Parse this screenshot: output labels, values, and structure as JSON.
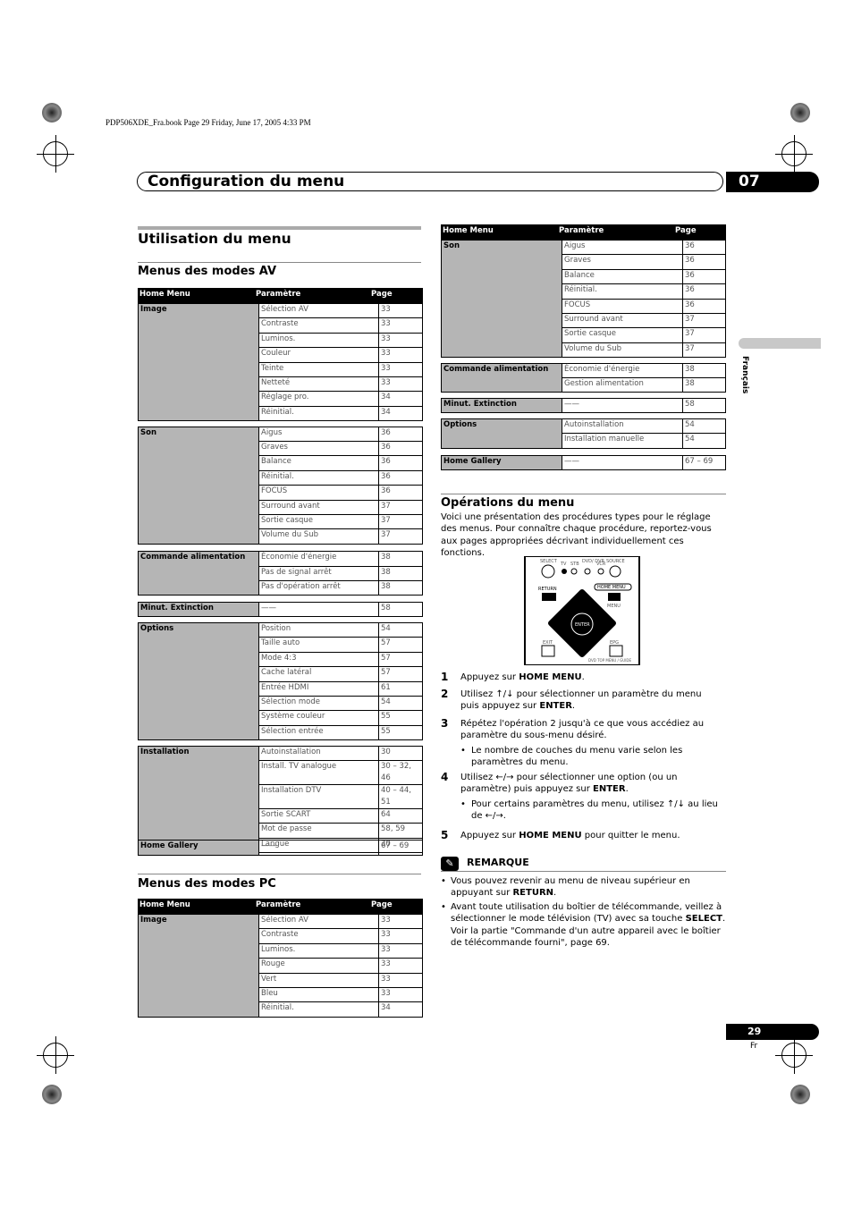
{
  "book_line": "PDP506XDE_Fra.book  Page 29  Friday, June 17, 2005  4:33 PM",
  "header": {
    "title": "Configuration du menu",
    "chapter": "07"
  },
  "side_tab": "Français",
  "section_title": "Utilisation du menu",
  "av": {
    "title": "Menus des modes AV",
    "columns": [
      "Home Menu",
      "Paramètre",
      "Page"
    ],
    "groups": [
      {
        "menu": "Image",
        "rows": [
          [
            "Sélection AV",
            "33"
          ],
          [
            "Contraste",
            "33"
          ],
          [
            "Luminos.",
            "33"
          ],
          [
            "Couleur",
            "33"
          ],
          [
            "Teinte",
            "33"
          ],
          [
            "Netteté",
            "33"
          ],
          [
            "Réglage pro.",
            "34"
          ],
          [
            "Réinitial.",
            "34"
          ]
        ]
      },
      {
        "menu": "Son",
        "rows": [
          [
            "Aigus",
            "36"
          ],
          [
            "Graves",
            "36"
          ],
          [
            "Balance",
            "36"
          ],
          [
            "Réinitial.",
            "36"
          ],
          [
            "FOCUS",
            "36"
          ],
          [
            "Surround avant",
            "37"
          ],
          [
            "Sortie casque",
            "37"
          ],
          [
            "Volume du Sub",
            "37"
          ]
        ]
      },
      {
        "menu": "Commande alimentation",
        "rows": [
          [
            "Économie d'énergie",
            "38"
          ],
          [
            "Pas de signal arrêt",
            "38"
          ],
          [
            "Pas d'opération arrêt",
            "38"
          ]
        ]
      },
      {
        "menu": "Minut. Extinction",
        "rows": [
          [
            "——",
            "58"
          ]
        ]
      },
      {
        "menu": "Options",
        "rows": [
          [
            "Position",
            "54"
          ],
          [
            "Taille auto",
            "57"
          ],
          [
            "Mode 4:3",
            "57"
          ],
          [
            "Cache latéral",
            "57"
          ],
          [
            "Entrée HDMI",
            "61"
          ],
          [
            "Sélection mode",
            "54"
          ],
          [
            "Système couleur",
            "55"
          ],
          [
            "Sélection entrée",
            "55"
          ]
        ]
      },
      {
        "menu": "Installation",
        "rows": [
          [
            "Autoinstallation",
            "30"
          ],
          [
            "Install. TV analogue",
            "30 – 32, 46"
          ],
          [
            "Installation DTV",
            "40 – 44, 51"
          ],
          [
            "Sortie SCART",
            "64"
          ],
          [
            "Mot de passe",
            "58, 59"
          ],
          [
            "Langue",
            "30"
          ]
        ]
      },
      {
        "menu": "Home Gallery",
        "rows": [
          [
            "——",
            "67 – 69"
          ]
        ]
      }
    ]
  },
  "pc": {
    "title": "Menus des modes PC",
    "columns": [
      "Home Menu",
      "Paramètre",
      "Page"
    ],
    "groups": [
      {
        "menu": "Image",
        "rows": [
          [
            "Sélection AV",
            "33"
          ],
          [
            "Contraste",
            "33"
          ],
          [
            "Luminos.",
            "33"
          ],
          [
            "Rouge",
            "33"
          ],
          [
            "Vert",
            "33"
          ],
          [
            "Bleu",
            "33"
          ],
          [
            "Réinitial.",
            "34"
          ]
        ]
      }
    ]
  },
  "pc_cont": {
    "columns": [
      "Home Menu",
      "Paramètre",
      "Page"
    ],
    "groups": [
      {
        "menu": "Son",
        "rows": [
          [
            "Aigus",
            "36"
          ],
          [
            "Graves",
            "36"
          ],
          [
            "Balance",
            "36"
          ],
          [
            "Réinitial.",
            "36"
          ],
          [
            "FOCUS",
            "36"
          ],
          [
            "Surround avant",
            "37"
          ],
          [
            "Sortie casque",
            "37"
          ],
          [
            "Volume du Sub",
            "37"
          ]
        ]
      },
      {
        "menu": "Commande alimentation",
        "rows": [
          [
            "Économie d'énergie",
            "38"
          ],
          [
            "Gestion alimentation",
            "38"
          ]
        ]
      },
      {
        "menu": "Minut. Extinction",
        "rows": [
          [
            "——",
            "58"
          ]
        ]
      },
      {
        "menu": "Options",
        "rows": [
          [
            "Autoinstallation",
            "54"
          ],
          [
            "Installation manuelle",
            "54"
          ]
        ]
      },
      {
        "menu": "Home Gallery",
        "rows": [
          [
            "——",
            "67 – 69"
          ]
        ]
      }
    ]
  },
  "ops": {
    "title": "Opérations du menu",
    "intro": "Voici une présentation des procédures types pour le réglage des menus. Pour connaître chaque procédure, reportez-vous aux pages appropriées décrivant individuellement ces fonctions.",
    "remote": {
      "select": "SELECT",
      "tv": "TV",
      "stb": "STB",
      "dvd": "DVD/ DVR",
      "vcr": "VCR",
      "source": "SOURCE",
      "return": "RETURN",
      "home_menu": "HOME MENU",
      "menu": "MENU",
      "enter": "ENTER",
      "exit": "EXIT",
      "epg": "EPG",
      "guide": "DVD TOP MENU / GUIDE"
    },
    "steps": [
      {
        "n": "1",
        "text": "Appuyez sur HOME MENU."
      },
      {
        "n": "2",
        "text": "Utilisez ↑/↓ pour sélectionner un paramètre du menu puis appuyez sur ENTER."
      },
      {
        "n": "3",
        "text": "Répétez l'opération 2 jusqu'à ce que vous accédiez au paramètre du sous-menu désiré.",
        "bullet": "Le nombre de couches du menu varie selon les paramètres du menu."
      },
      {
        "n": "4",
        "text": "Utilisez ←/→ pour sélectionner une option (ou un paramètre) puis appuyez sur  ENTER.",
        "bullet": "Pour certains paramètres du menu, utilisez ↑/↓ au lieu de ←/→."
      },
      {
        "n": "5",
        "text": "Appuyez sur HOME MENU pour quitter le menu."
      }
    ]
  },
  "remarque": {
    "title": "REMARQUE",
    "items": [
      "Vous pouvez revenir au menu de niveau supérieur en appuyant sur RETURN.",
      "Avant toute utilisation du boîtier de télécommande, veillez à sélectionner le mode télévision (TV) avec sa touche SELECT. Voir la partie \"Commande d'un autre appareil avec le boîtier de télécommande fourni\", page 69."
    ]
  },
  "footer": {
    "page": "29",
    "lang": "Fr"
  }
}
